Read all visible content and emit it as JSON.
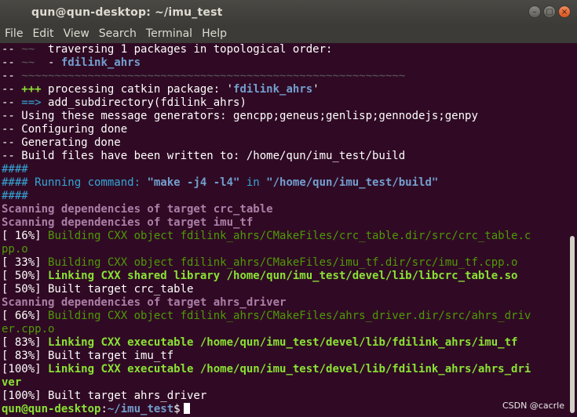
{
  "window": {
    "title": "qun@qun-desktop: ~/imu_test",
    "buttons": [
      "–",
      "□",
      "×"
    ]
  },
  "menu": [
    "File",
    "Edit",
    "View",
    "Search",
    "Terminal",
    "Help"
  ],
  "terminal": {
    "lines": [
      [
        [
          "-- ",
          "w"
        ],
        [
          "~~",
          "dim"
        ],
        [
          "  traversing 1 packages in topological order:",
          "w"
        ]
      ],
      [
        [
          "-- ",
          "w"
        ],
        [
          "~~",
          "dim"
        ],
        [
          "  - ",
          "w"
        ],
        [
          "fdilink_ahrs",
          "bb"
        ]
      ],
      [
        [
          "-- ",
          "w"
        ],
        [
          "~~~~~~~~~~~~~~~~~~~~~~~~~~~~~~~~~~~~~~~~~~~~~~~~~~~~~~~~~~",
          "dim"
        ]
      ],
      [
        [
          "-- ",
          "w"
        ],
        [
          "+++",
          "gb"
        ],
        [
          " processing catkin package: '",
          "w"
        ],
        [
          "fdilink_ahrs",
          "bb"
        ],
        [
          "'",
          "w"
        ]
      ],
      [
        [
          "-- ",
          "w"
        ],
        [
          "==>",
          "b"
        ],
        [
          " add_subdirectory(fdilink_ahrs)",
          "w"
        ]
      ],
      [
        [
          "-- Using these message generators: gencpp;geneus;genlisp;gennodejs;genpy",
          "w"
        ]
      ],
      [
        [
          "-- Configuring done",
          "w"
        ]
      ],
      [
        [
          "-- Generating done",
          "w"
        ]
      ],
      [
        [
          "-- Build files have been written to: /home/qun/imu_test/build",
          "w"
        ]
      ],
      [
        [
          "####",
          "b"
        ]
      ],
      [
        [
          "#### Running command: ",
          "b"
        ],
        [
          "\"make -j4 -l4\"",
          "bb"
        ],
        [
          " in ",
          "b"
        ],
        [
          "\"/home/qun/imu_test/build\"",
          "bb"
        ]
      ],
      [
        [
          "####",
          "b"
        ]
      ],
      [
        [
          "Scanning dependencies of target crc_table",
          "pb"
        ]
      ],
      [
        [
          "Scanning dependencies of target imu_tf",
          "pb"
        ]
      ],
      [
        [
          "[ 16%] ",
          "w"
        ],
        [
          "Building CXX object fdilink_ahrs/CMakeFiles/crc_table.dir/src/crc_table.c",
          "g"
        ]
      ],
      [
        [
          "pp.o",
          "g"
        ]
      ],
      [
        [
          "[ 33%] ",
          "w"
        ],
        [
          "Building CXX object fdilink_ahrs/CMakeFiles/imu_tf.dir/src/imu_tf.cpp.o",
          "g"
        ]
      ],
      [
        [
          "[ 50%] ",
          "w"
        ],
        [
          "Linking CXX shared library /home/qun/imu_test/devel/lib/libcrc_table.so",
          "gb"
        ]
      ],
      [
        [
          "[ 50%] Built target crc_table",
          "w"
        ]
      ],
      [
        [
          "Scanning dependencies of target ahrs_driver",
          "pb"
        ]
      ],
      [
        [
          "[ 66%] ",
          "w"
        ],
        [
          "Building CXX object fdilink_ahrs/CMakeFiles/ahrs_driver.dir/src/ahrs_driv",
          "g"
        ]
      ],
      [
        [
          "er.cpp.o",
          "g"
        ]
      ],
      [
        [
          "[ 83%] ",
          "w"
        ],
        [
          "Linking CXX executable /home/qun/imu_test/devel/lib/fdilink_ahrs/imu_tf",
          "gb"
        ]
      ],
      [
        [
          "[ 83%] Built target imu_tf",
          "w"
        ]
      ],
      [
        [
          "[100%] ",
          "w"
        ],
        [
          "Linking CXX executable /home/qun/imu_test/devel/lib/fdilink_ahrs/ahrs_dri",
          "gb"
        ]
      ],
      [
        [
          "ver",
          "gb"
        ]
      ],
      [
        [
          "[100%] Built target ahrs_driver",
          "w"
        ]
      ]
    ],
    "prompt_user": "qun@qun-desktop",
    "prompt_colon": ":",
    "prompt_path": "~/imu_test",
    "prompt_symbol": "$"
  },
  "watermark": "CSDN @cacrle"
}
